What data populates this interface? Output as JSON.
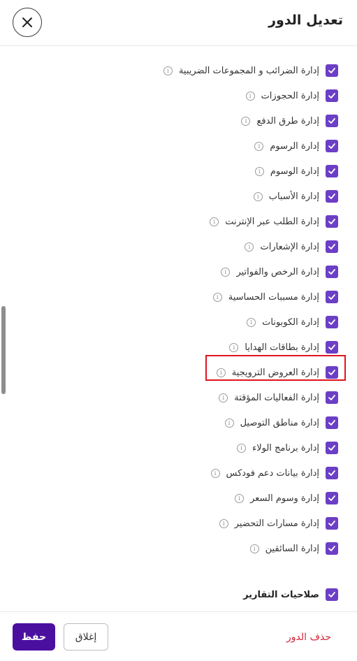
{
  "header": {
    "title": "تعديل الدور"
  },
  "permissions": [
    {
      "label": "إدارة الضرائب و المجموعات الضريبية",
      "checked": true
    },
    {
      "label": "إدارة الحجوزات",
      "checked": true
    },
    {
      "label": "إدارة طرق الدفع",
      "checked": true
    },
    {
      "label": "إدارة الرسوم",
      "checked": true
    },
    {
      "label": "إدارة الوسوم",
      "checked": true
    },
    {
      "label": "إدارة الأسباب",
      "checked": true
    },
    {
      "label": "إدارة الطلب عبر الإنترنت",
      "checked": true
    },
    {
      "label": "إدارة الإشعارات",
      "checked": true
    },
    {
      "label": "إدارة الرخص والفواتير",
      "checked": true
    },
    {
      "label": "إدارة مسببات الحساسية",
      "checked": true
    },
    {
      "label": "إدارة الكوبونات",
      "checked": true
    },
    {
      "label": "إدارة بطاقات الهدايا",
      "checked": true
    },
    {
      "label": "إدارة العروض الترويجية",
      "checked": true
    },
    {
      "label": "إدارة الفعاليات المؤقتة",
      "checked": true
    },
    {
      "label": "إدارة مناطق التوصيل",
      "checked": true
    },
    {
      "label": "إدارة برنامج الولاء",
      "checked": true
    },
    {
      "label": "إدارة بيانات دعم فودكس",
      "checked": true
    },
    {
      "label": "إدارة وسوم السعر",
      "checked": true
    },
    {
      "label": "إدارة مسارات التحضير",
      "checked": true
    },
    {
      "label": "إدارة السائقين",
      "checked": true
    }
  ],
  "reports_section": {
    "label": "صلاحيات التقارير",
    "checked": true
  },
  "footer": {
    "save_label": "حفظ",
    "close_label": "إغلاق",
    "delete_label": "حذف الدور"
  },
  "colors": {
    "checkbox": "#6b3fc6",
    "primary_button": "#4b0fa0",
    "delete_text": "#d5293a",
    "highlight_border": "#e0141e"
  },
  "icons": {
    "close": "close-icon",
    "info": "info-icon",
    "check": "check-icon"
  }
}
